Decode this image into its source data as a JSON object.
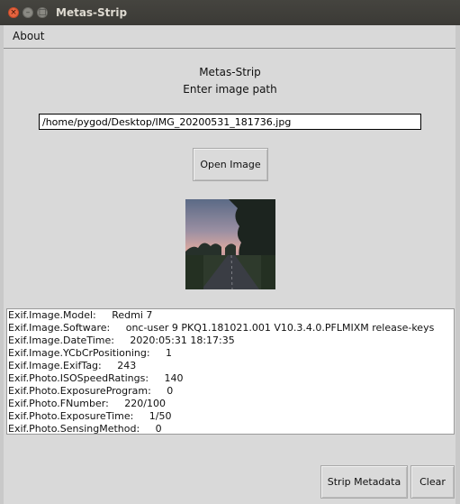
{
  "window": {
    "title": "Metas-Strip",
    "close_glyph": "×",
    "min_glyph": "–",
    "max_glyph": "□"
  },
  "menu": {
    "about_label": "About"
  },
  "header": {
    "title": "Metas-Strip",
    "subtitle": "Enter image path"
  },
  "path_input": {
    "value": "/home/pygod/Desktop/IMG_20200531_181736.jpg"
  },
  "buttons": {
    "open_label": "Open Image",
    "strip_label": "Strip Metadata",
    "clear_label": "Clear"
  },
  "preview": {
    "icon": "image-thumbnail"
  },
  "metadata": [
    "Exif.Image.Model:     Redmi 7",
    "Exif.Image.Software:     onc-user 9 PKQ1.181021.001 V10.3.4.0.PFLMIXM release-keys",
    "Exif.Image.DateTime:     2020:05:31 18:17:35",
    "Exif.Image.YCbCrPositioning:     1",
    "Exif.Image.ExifTag:     243",
    "Exif.Photo.ISOSpeedRatings:     140",
    "Exif.Photo.ExposureProgram:     0",
    "Exif.Photo.FNumber:     220/100",
    "Exif.Photo.ExposureTime:     1/50",
    "Exif.Photo.SensingMethod:     0"
  ]
}
